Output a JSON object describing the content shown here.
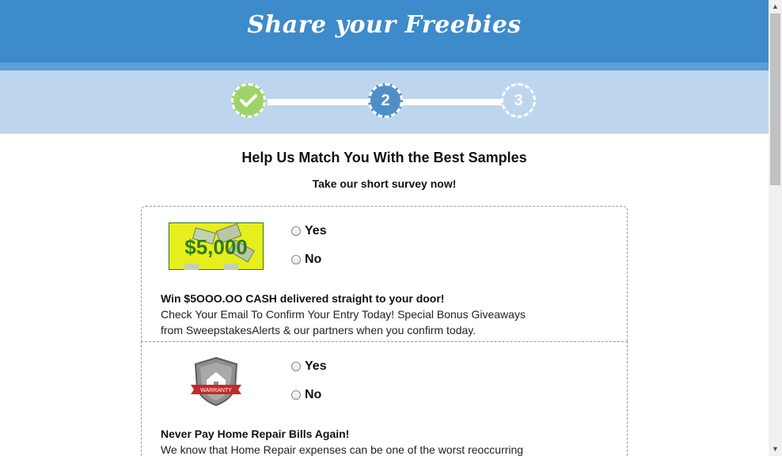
{
  "header": {
    "title": "Share your Freebies"
  },
  "progress": {
    "steps": [
      {
        "label": "✓"
      },
      {
        "label": "2"
      },
      {
        "label": "3"
      }
    ]
  },
  "main": {
    "heading": "Help Us Match You With the Best Samples",
    "subheading": "Take our short survey now!"
  },
  "offers": [
    {
      "image_icon": "cash-prize-image",
      "image_text": "$5,000",
      "yes_label": "Yes",
      "no_label": "No",
      "title": "Win $5OOO.OO CASH delivered straight to your door!",
      "description_line1": "Check Your Email To Confirm Your Entry Today! Special Bonus Giveaways",
      "description_line2": "from SweepstakesAlerts & our partners when you confirm today."
    },
    {
      "image_icon": "home-warranty-shield-image",
      "image_text": "WARRANTY",
      "yes_label": "Yes",
      "no_label": "No",
      "title": "Never Pay Home Repair Bills Again!",
      "description_line1": "We know that Home Repair expenses can be one of the worst reoccurring"
    }
  ],
  "colors": {
    "header": "#3d8bcb",
    "progress_bg": "#bdd6ee",
    "step_done": "#9ed36a",
    "step_active": "#4f8fc8"
  }
}
